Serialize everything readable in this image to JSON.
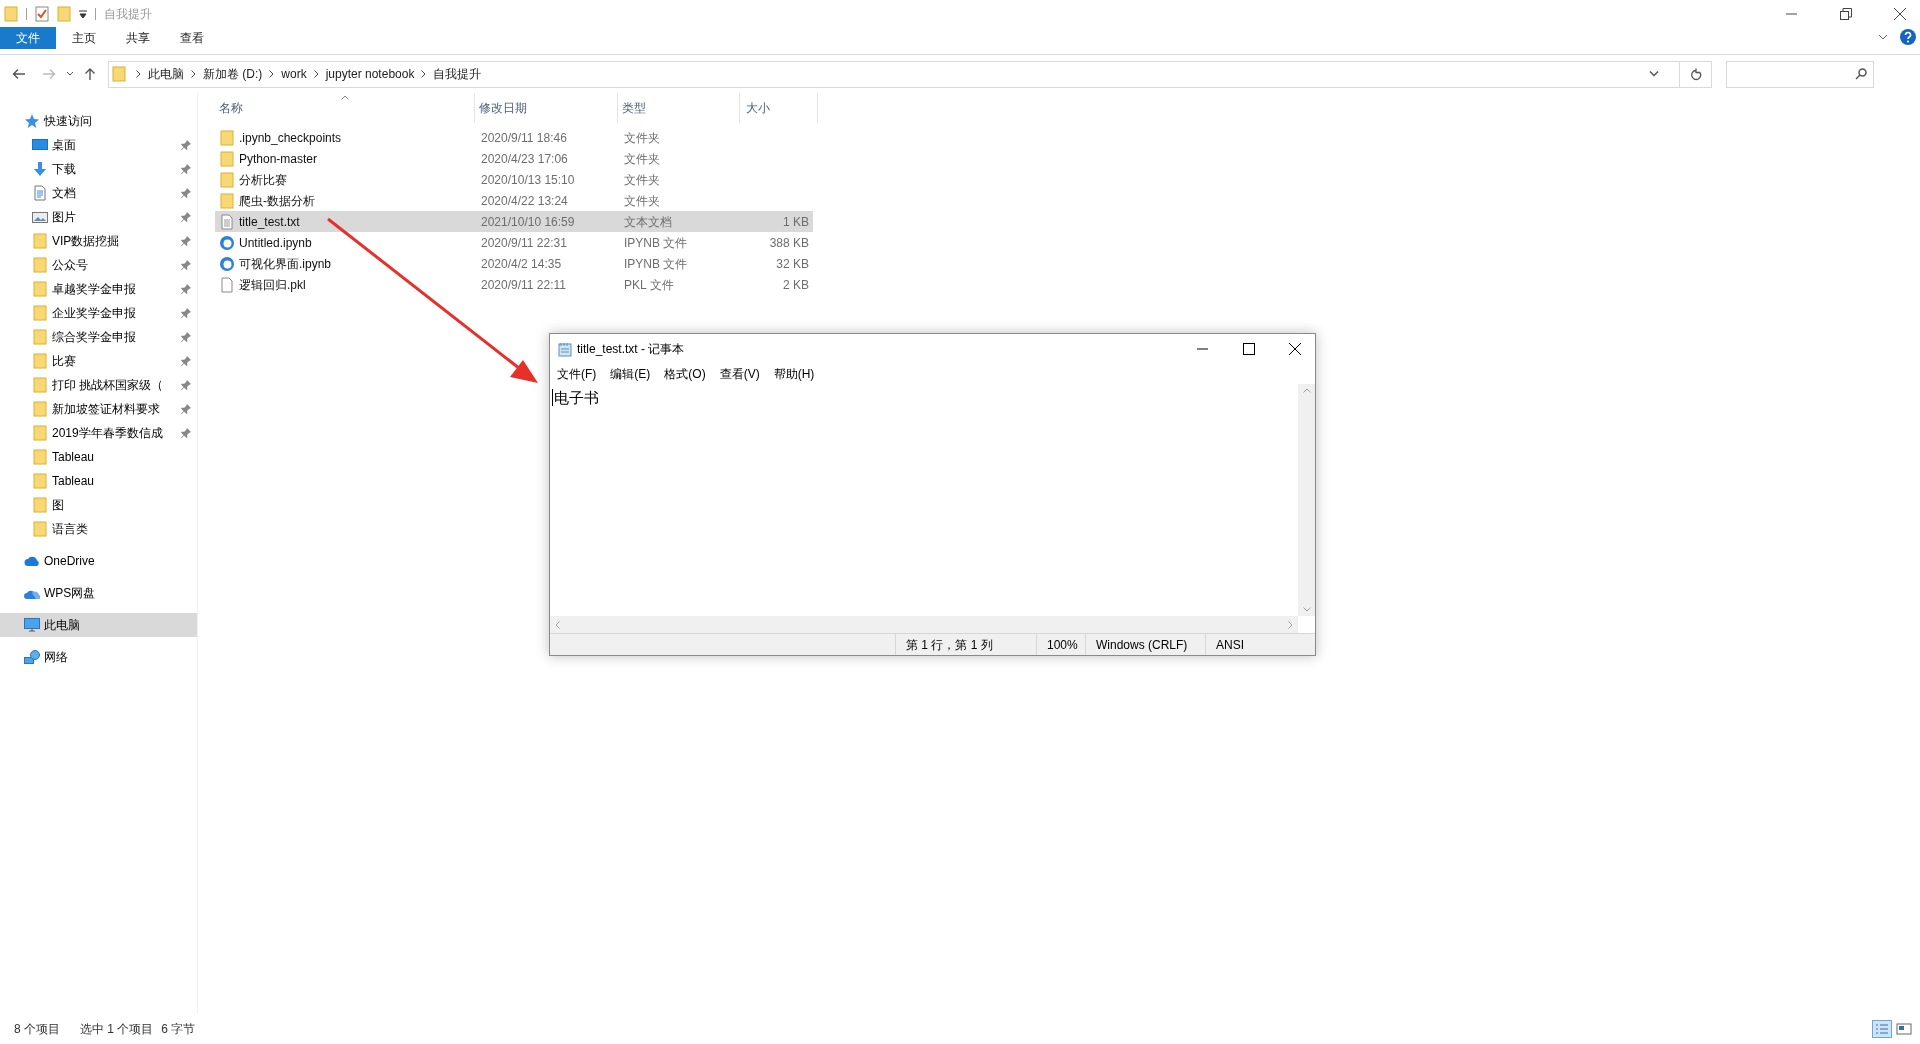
{
  "window": {
    "title": "自我提升"
  },
  "ribbon_tabs": [
    {
      "label": "文件",
      "selected": true
    },
    {
      "label": "主页",
      "selected": false
    },
    {
      "label": "共享",
      "selected": false
    },
    {
      "label": "查看",
      "selected": false
    }
  ],
  "address": {
    "breadcrumbs": [
      "此电脑",
      "新加卷 (D:)",
      "work",
      "jupyter notebook",
      "自我提升"
    ]
  },
  "navigation": [
    {
      "label": "快速访问",
      "kind": "star",
      "selected": false,
      "children": [
        {
          "label": "桌面",
          "kind": "desktop",
          "pinned": true
        },
        {
          "label": "下载",
          "kind": "download",
          "pinned": true
        },
        {
          "label": "文档",
          "kind": "document",
          "pinned": true
        },
        {
          "label": "图片",
          "kind": "pictures",
          "pinned": true
        },
        {
          "label": "VIP数据挖掘",
          "kind": "folder",
          "pinned": true
        },
        {
          "label": "公众号",
          "kind": "folder",
          "pinned": true
        },
        {
          "label": "卓越奖学金申报",
          "kind": "folder",
          "pinned": true
        },
        {
          "label": "企业奖学金申报",
          "kind": "folder",
          "pinned": true
        },
        {
          "label": "综合奖学金申报",
          "kind": "folder",
          "pinned": true
        },
        {
          "label": "比赛",
          "kind": "folder",
          "pinned": true
        },
        {
          "label": "打印 挑战杯国家级（",
          "kind": "folder",
          "pinned": true
        },
        {
          "label": "新加坡签证材料要求",
          "kind": "folder",
          "pinned": true
        },
        {
          "label": "2019学年春季数信成",
          "kind": "folder",
          "pinned": true
        },
        {
          "label": "Tableau",
          "kind": "folder",
          "pinned": false
        },
        {
          "label": "Tableau",
          "kind": "folder",
          "pinned": false
        },
        {
          "label": "图",
          "kind": "folder",
          "pinned": false
        },
        {
          "label": "语言类",
          "kind": "folder",
          "pinned": false
        }
      ]
    },
    {
      "label": "OneDrive",
      "kind": "cloud",
      "selected": false
    },
    {
      "label": "WPS网盘",
      "kind": "wps",
      "selected": false
    },
    {
      "label": "此电脑",
      "kind": "pc",
      "selected": true
    },
    {
      "label": "网络",
      "kind": "network",
      "selected": false
    }
  ],
  "file_list": {
    "columns": [
      "名称",
      "修改日期",
      "类型",
      "大小"
    ],
    "rows": [
      {
        "name": ".ipynb_checkpoints",
        "date": "2020/9/11 18:46",
        "type": "文件夹",
        "kind": "folder",
        "selected": false
      },
      {
        "name": "Python-master",
        "date": "2020/4/23 17:06",
        "type": "文件夹",
        "kind": "folder",
        "selected": false
      },
      {
        "name": "分析比赛",
        "date": "2020/10/13 15:10",
        "type": "文件夹",
        "kind": "folder",
        "selected": false
      },
      {
        "name": "爬虫-数据分析",
        "date": "2020/4/22 13:24",
        "type": "文件夹",
        "kind": "folder",
        "selected": false
      },
      {
        "name": "title_test.txt",
        "date": "2021/10/10 16:59",
        "type": "文本文档",
        "size": "1 KB",
        "kind": "text",
        "selected": true
      },
      {
        "name": "Untitled.ipynb",
        "date": "2020/9/11 22:31",
        "type": "IPYNB 文件",
        "size": "388 KB",
        "kind": "notebook",
        "selected": false
      },
      {
        "name": "可视化界面.ipynb",
        "date": "2020/4/2 14:35",
        "type": "IPYNB 文件",
        "size": "32 KB",
        "kind": "notebook",
        "selected": false
      },
      {
        "name": "逻辑回归.pkl",
        "date": "2020/9/11 22:11",
        "type": "PKL 文件",
        "size": "2 KB",
        "kind": "blank",
        "selected": false
      }
    ]
  },
  "notepad": {
    "title": "title_test.txt - 记事本",
    "menu": [
      "文件(F)",
      "编辑(E)",
      "格式(O)",
      "查看(V)",
      "帮助(H)"
    ],
    "content": "电子书",
    "status": [
      "第 1 行，第 1 列",
      "100%",
      "Windows (CRLF)",
      "ANSI"
    ]
  },
  "status_bar": {
    "item_count": "8 个项目",
    "selection": "选中 1 个项目",
    "selection_size": "6 字节"
  }
}
